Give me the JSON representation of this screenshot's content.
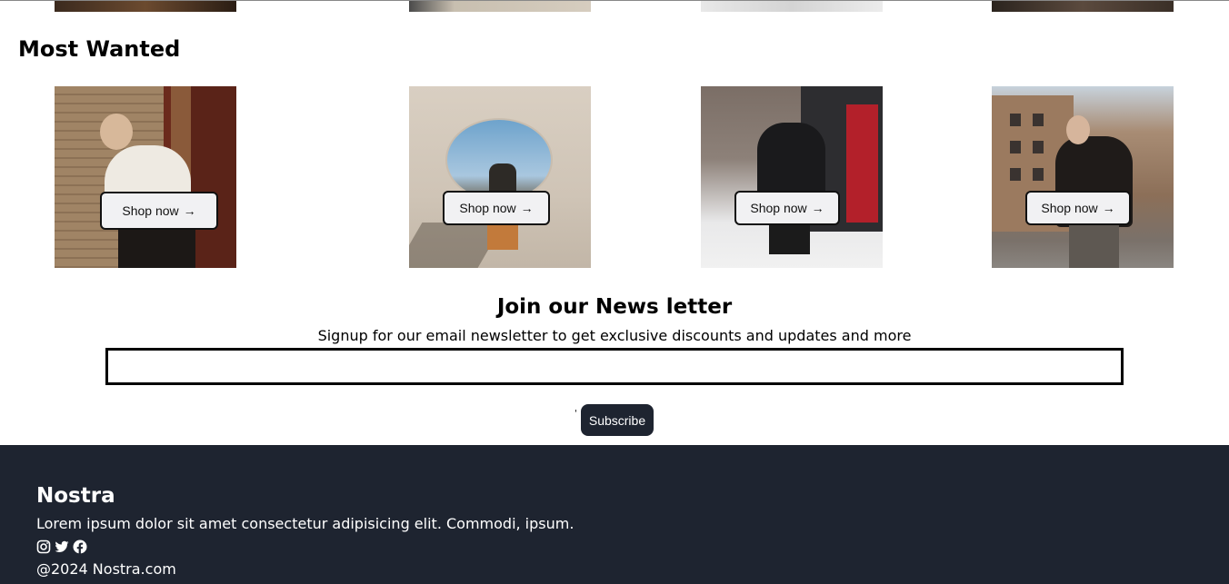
{
  "most_wanted": {
    "title": "Most Wanted",
    "cards": [
      {
        "button_label": "Shop now"
      },
      {
        "button_label": "Shop now"
      },
      {
        "button_label": "Shop now"
      },
      {
        "button_label": "Shop now"
      }
    ]
  },
  "newsletter": {
    "title": "Join our News letter",
    "subtitle": "Signup for our email newsletter to get exclusive discounts and updates and more",
    "email_value": "",
    "stray_char": "'",
    "subscribe_label": "Subscribe"
  },
  "footer": {
    "brand": "Nostra",
    "tagline": "Lorem ipsum dolor sit amet consectetur adipisicing elit. Commodi, ipsum.",
    "social_icons": [
      "instagram-icon",
      "twitter-icon",
      "facebook-icon"
    ],
    "copyright": "@2024 Nostra.com",
    "background_color": "#1e2430"
  },
  "colors": {
    "dark": "#1e2430",
    "button_bg": "#f1f1f3"
  }
}
